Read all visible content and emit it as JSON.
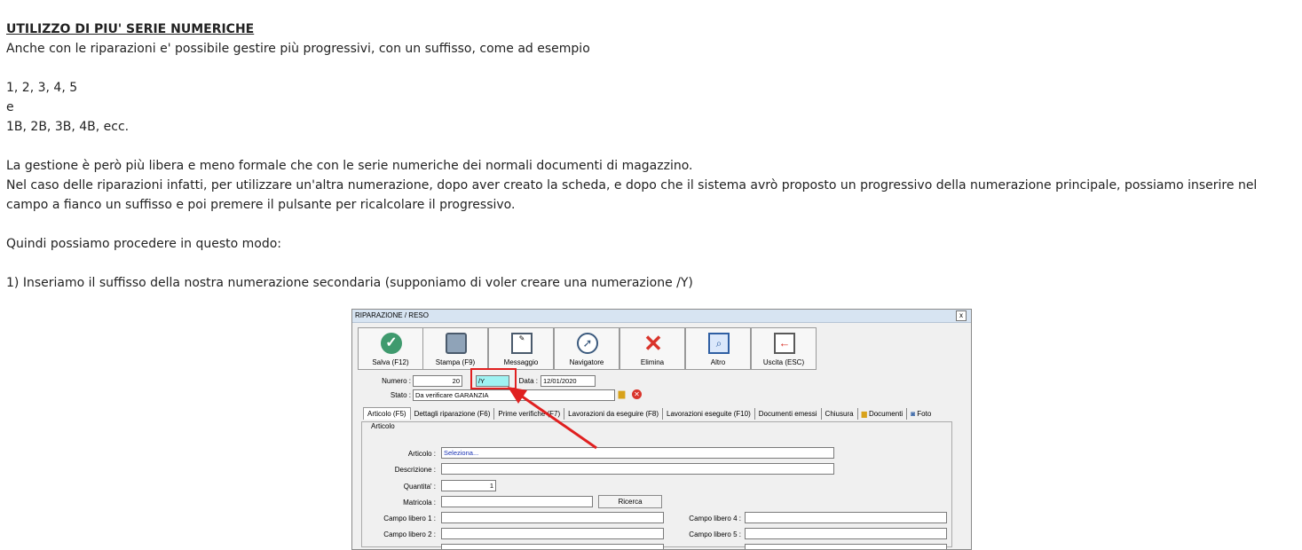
{
  "doc": {
    "title": "UTILIZZO DI PIU' SERIE NUMERICHE",
    "lines": [
      "Anche con le riparazioni e' possibile gestire più progressivi, con un suffisso, come ad esempio",
      "1, 2, 3, 4, 5",
      "e",
      "1B, 2B, 3B, 4B, ecc.",
      "La gestione è però più libera e meno formale che con le serie numeriche dei normali documenti di magazzino.",
      "Nel caso delle riparazioni infatti, per utilizzare un'altra numerazione, dopo aver creato la scheda, e dopo che il sistema avrò proposto un progressivo della numerazione principale, possiamo inserire nel campo a fianco un suffisso e poi premere il pulsante per ricalcolare il progressivo.",
      "Quindi possiamo procedere in questo modo:",
      "1) Inseriamo il suffisso della nostra numerazione secondaria (supponiamo di voler creare una numerazione /Y)"
    ]
  },
  "screenshot": {
    "window_title": "RIPARAZIONE / RESO",
    "close_label": "x",
    "toolbar": [
      {
        "label": "Salva (F12)",
        "icon": "check-icon",
        "glyph": "✓"
      },
      {
        "label": "Stampa (F9)",
        "icon": "printer-icon",
        "glyph": ""
      },
      {
        "label": "Messaggio",
        "icon": "message-icon",
        "glyph": "✎"
      },
      {
        "label": "Navigatore",
        "icon": "compass-icon",
        "glyph": "➚"
      },
      {
        "label": "Elimina",
        "icon": "delete-icon",
        "glyph": "✕"
      },
      {
        "label": "Altro",
        "icon": "magnifier-icon",
        "glyph": "🔍"
      },
      {
        "label": "Uscita (ESC)",
        "icon": "exit-icon",
        "glyph": "←"
      }
    ],
    "header": {
      "numero_label": "Numero :",
      "numero_value": "20",
      "suffix_value": "/Y",
      "data_label": "Data :",
      "data_value": "12/01/2020",
      "stato_label": "Stato :",
      "stato_value": "Da verificare GARANZIA"
    },
    "tabs": [
      "Articolo (F5)",
      "Dettagli riparazione (F6)",
      "Prime verifiche (F7)",
      "Lavorazioni da eseguire (F8)",
      "Lavorazioni eseguite  (F10)",
      "Documenti emessi",
      "Chiusura",
      "Documenti",
      "Foto"
    ],
    "group_label": "Articolo",
    "form": {
      "articolo_label": "Articolo :",
      "articolo_value": "Seleziona...",
      "descrizione_label": "Descrizione :",
      "quantita_label": "Quantita' :",
      "quantita_value": "1",
      "matricola_label": "Matricola :",
      "ricerca_label": "Ricerca",
      "campo1_label": "Campo libero 1 :",
      "campo2_label": "Campo libero 2 :",
      "campo4_label": "Campo libero 4 :",
      "campo5_label": "Campo libero 5 :"
    }
  }
}
